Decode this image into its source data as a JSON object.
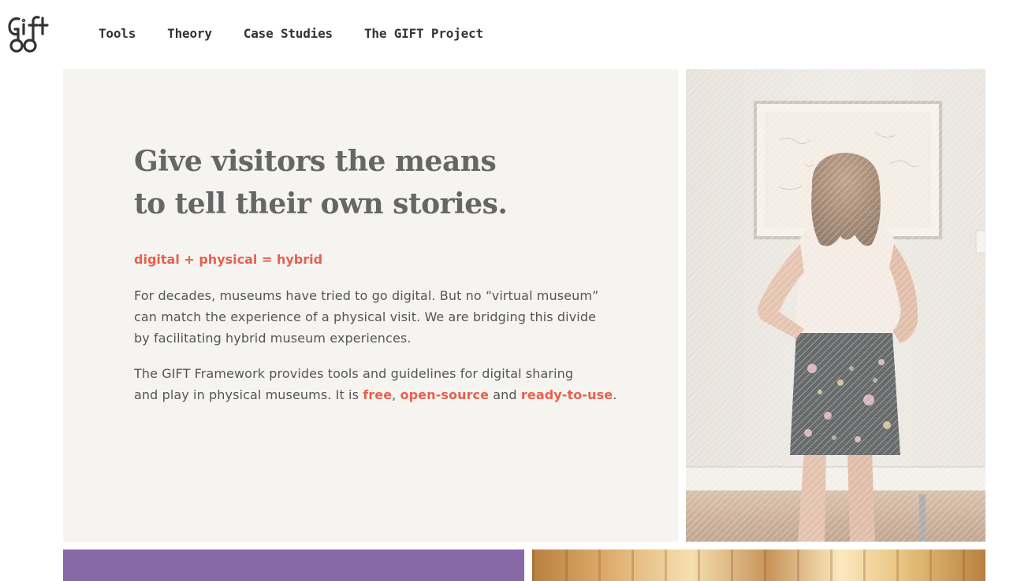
{
  "header": {
    "logo_alt": "GIFT",
    "nav": [
      {
        "label": "Tools"
      },
      {
        "label": "Theory"
      },
      {
        "label": "Case Studies"
      },
      {
        "label": "The GIFT Project"
      }
    ]
  },
  "hero": {
    "title_line1": "Give visitors the means",
    "title_line2": "to tell their own stories.",
    "tagline": "digital + physical = hybrid",
    "para1": {
      "line1": "For decades, museums have tried to go digital. But no “virtual museum”",
      "line2": "can match the experience of a physical visit. We are bridging this divide",
      "line3": "by facilitating hybrid museum experiences."
    },
    "para2": {
      "line1": "The GIFT Framework provides tools and guidelines for digital sharing",
      "line2_prefix": "and play in physical museums. It is ",
      "link_free": "free",
      "sep1": ", ",
      "link_open_source": "open-source",
      "sep2": " and ",
      "link_ready": "ready-to-use",
      "end": "."
    }
  },
  "colors": {
    "accent": "#e8604c",
    "panel_bg": "#f5f4f0",
    "title": "#666666",
    "body_text": "#555555",
    "purple": "#8769a8"
  }
}
